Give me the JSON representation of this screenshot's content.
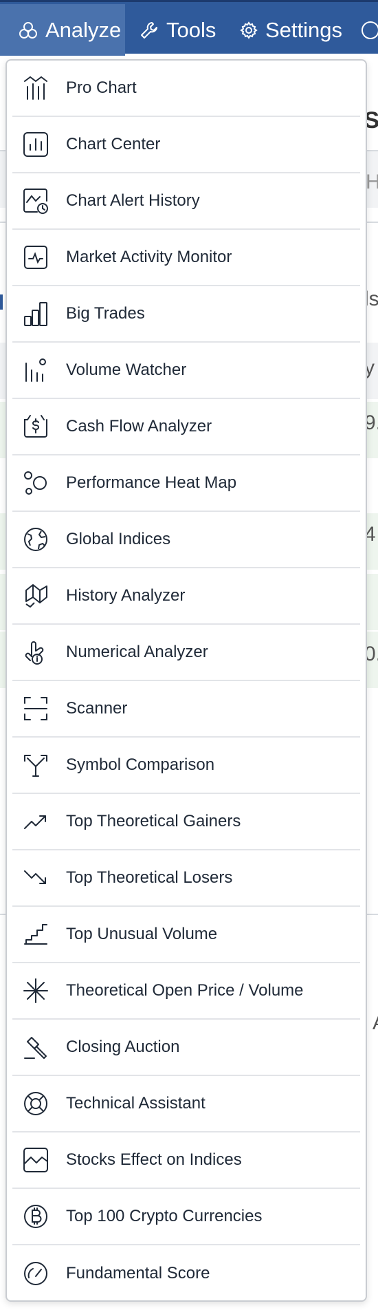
{
  "nav": {
    "analyze_label": "Analyze",
    "tools_label": "Tools",
    "settings_label": "Settings",
    "active_tab": "Analyze",
    "bar_color": "#2f5a9b",
    "active_color": "#4a72ad"
  },
  "menu": {
    "items": [
      {
        "label": "Pro Chart",
        "icon": "pro-chart-icon"
      },
      {
        "label": "Chart Center",
        "icon": "bar-chart-icon"
      },
      {
        "label": "Chart Alert History",
        "icon": "chart-alert-clock-icon"
      },
      {
        "label": "Market Activity Monitor",
        "icon": "pulse-monitor-icon"
      },
      {
        "label": "Big Trades",
        "icon": "ascending-bars-icon"
      },
      {
        "label": "Volume Watcher",
        "icon": "volume-bars-icon"
      },
      {
        "label": "Cash Flow Analyzer",
        "icon": "dollar-cash-icon"
      },
      {
        "label": "Performance Heat Map",
        "icon": "bubbles-icon"
      },
      {
        "label": "Global Indices",
        "icon": "globe-icon"
      },
      {
        "label": "History Analyzer",
        "icon": "map-history-icon"
      },
      {
        "label": "Numerical Analyzer",
        "icon": "hand-info-icon"
      },
      {
        "label": "Scanner",
        "icon": "scanner-frame-icon"
      },
      {
        "label": "Symbol Comparison",
        "icon": "split-arrows-icon"
      },
      {
        "label": "Top Theoretical Gainers",
        "icon": "trend-up-icon"
      },
      {
        "label": "Top Theoretical Losers",
        "icon": "trend-down-icon"
      },
      {
        "label": "Top Unusual Volume",
        "icon": "unusual-volume-icon"
      },
      {
        "label": "Theoretical Open Price / Volume",
        "icon": "asterisk-icon"
      },
      {
        "label": "Closing Auction",
        "icon": "gavel-icon"
      },
      {
        "label": "Technical Assistant",
        "icon": "lifebuoy-icon"
      },
      {
        "label": "Stocks Effect on Indices",
        "icon": "line-chart-box-icon"
      },
      {
        "label": "Top 100 Crypto Currencies",
        "icon": "bitcoin-icon"
      },
      {
        "label": "Fundamental Score",
        "icon": "gauge-icon"
      }
    ]
  },
  "background": {
    "fragments": [
      ",S",
      "HE",
      "ls",
      "y",
      "9.",
      "4",
      "0.",
      "A"
    ]
  }
}
